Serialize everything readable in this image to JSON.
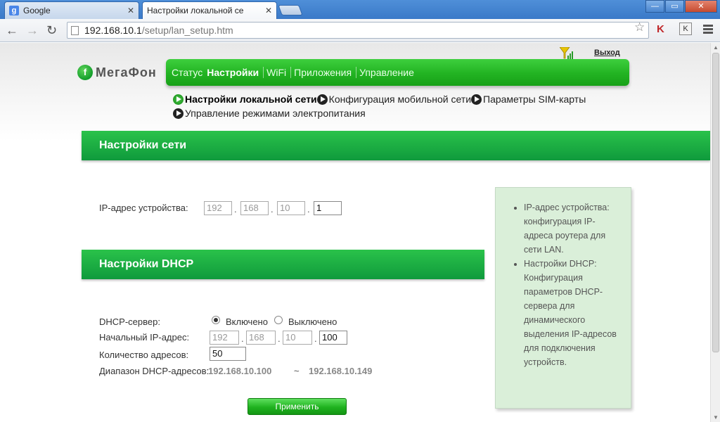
{
  "browser": {
    "tabs": [
      {
        "title": "Google",
        "active": false
      },
      {
        "title": "Настройки локальной се",
        "active": true
      }
    ],
    "url_host": "192.168.10.1",
    "url_path": "/setup/lan_setup.htm",
    "window_controls": {
      "minimize": "—",
      "maximize": "▭",
      "close": "✕"
    }
  },
  "header": {
    "logo_text": "МегаФон",
    "logo_mark": "f",
    "exit_label": "Выход"
  },
  "main_nav": [
    "Статус",
    "Настройки",
    "WiFi",
    "Приложения",
    "Управление"
  ],
  "main_nav_active": "Настройки",
  "sub_nav": [
    {
      "label": "Настройки локальной сети",
      "active": true
    },
    {
      "label": "Конфигурация мобильной сети",
      "active": false
    },
    {
      "label": "Параметры SIM-карты",
      "active": false
    },
    {
      "label": "Управление режимами электропитания",
      "active": false
    }
  ],
  "network_section": {
    "title": "Настройки сети",
    "ip_label": "IP-адрес устройства:",
    "ip": [
      "192",
      "168",
      "10",
      "1"
    ]
  },
  "dhcp_section": {
    "title": "Настройки DHCP",
    "server_label": "DHCP-сервер:",
    "on_label": "Включено",
    "off_label": "Выключено",
    "server_enabled": true,
    "start_ip_label": "Начальный IP-адрес:",
    "start_ip": [
      "192",
      "168",
      "10",
      "100"
    ],
    "count_label": "Количество адресов:",
    "count": "50",
    "range_label": "Диапазон DHCP-адресов:",
    "range_start": "192.168.10.100",
    "range_sep": "~",
    "range_end": "192.168.10.149"
  },
  "apply_label": "Применить",
  "help": [
    "IP-адрес устройства: конфигурация IP-адреса роутера для сети LAN.",
    "Настройки DHCP: Конфигурация параметров DHCP-сервера для динамического выделения IP-адресов для подключения устройств."
  ],
  "colors": {
    "brand_green": "#22b322",
    "section_green": "#0f9a3c",
    "help_bg": "#daefd9"
  }
}
